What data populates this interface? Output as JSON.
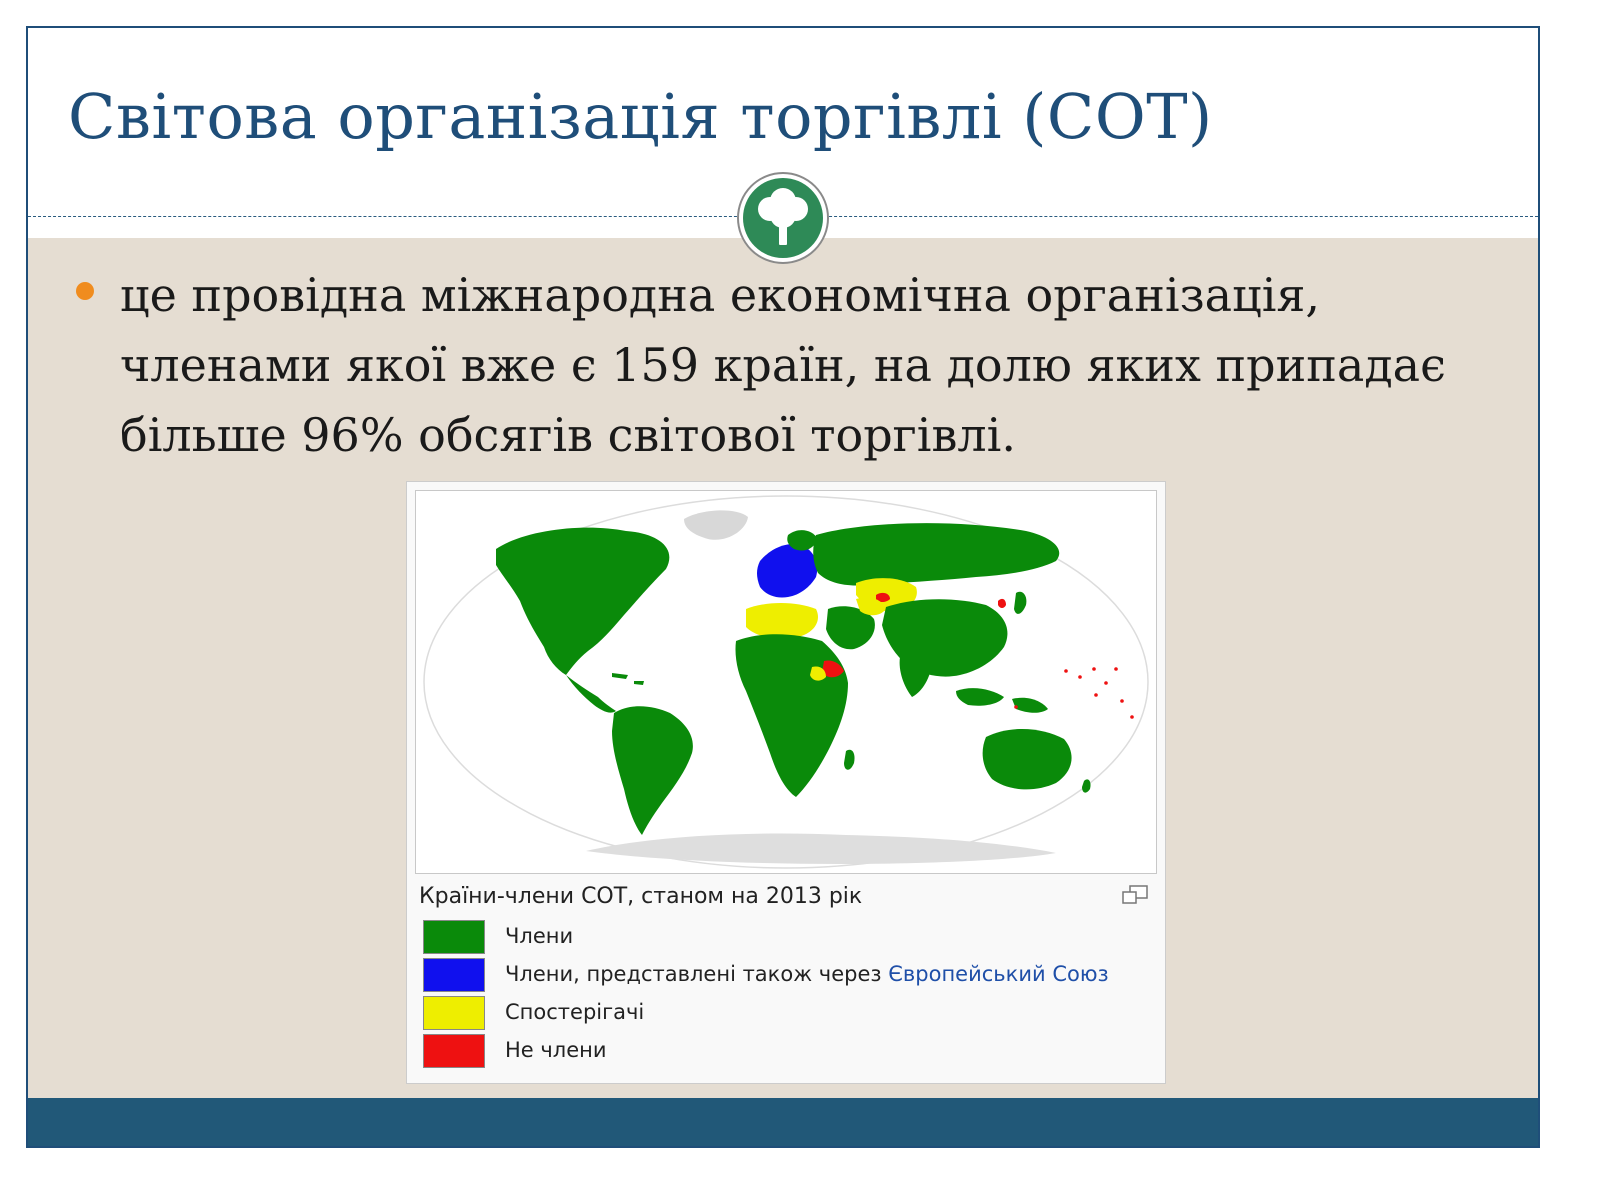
{
  "slide": {
    "title": "Світова організація торгівлі (СОТ)",
    "bullet": "це провідна міжнародна економічна організація, членами якої вже є 159 країн, на долю яких припадає більше 96% обсягів світової торгівлі."
  },
  "figure": {
    "caption": "Країни-члени СОТ, станом на 2013 рік",
    "legend": [
      {
        "label": "Члени",
        "link": "",
        "color": "#0a8a0a"
      },
      {
        "label": "Члени, представлені також через ",
        "link": "Європейський Союз",
        "color": "#1010ee"
      },
      {
        "label": "Спостерігачі",
        "link": "",
        "color": "#eeee00"
      },
      {
        "label": "Не члени",
        "link": "",
        "color": "#ee1111"
      }
    ]
  },
  "colors": {
    "title": "#1f4e79",
    "content_bg": "#e5ddd2",
    "footer": "#215878",
    "bullet": "#f08c1e",
    "emblem": "#2e8a57"
  },
  "icons": {
    "emblem": "tree-icon",
    "enlarge": "enlarge-icon"
  }
}
